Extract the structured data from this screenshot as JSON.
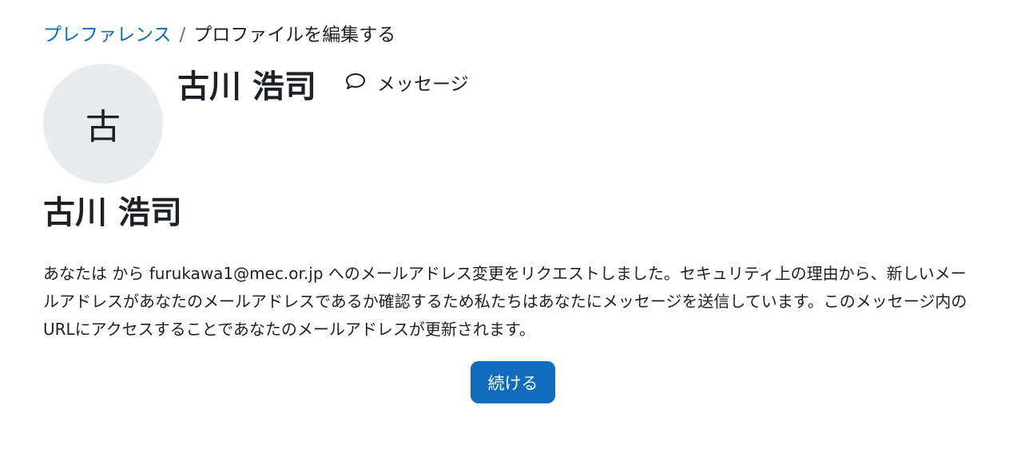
{
  "breadcrumb": {
    "items": [
      {
        "label": "プレファレンス"
      },
      {
        "label": "プロファイルを編集する"
      }
    ],
    "separator": "/"
  },
  "profile": {
    "avatar_initial": "古",
    "name": "古川 浩司",
    "message_label": "メッセージ",
    "message_icon": "chat-bubble-icon"
  },
  "page": {
    "heading": "古川 浩司",
    "body": "あなたは から furukawa1@mec.or.jp へのメールアドレス変更をリクエストしました。セキュリティ上の理由から、新しいメールアドレスがあなたのメールアドレスであるか確認するため私たちはあなたにメッセージを送信しています。このメッセージ内のURLにアクセスすることであなたのメールアドレスが更新されます。",
    "continue_label": "続ける"
  },
  "colors": {
    "link": "#0f6cbf",
    "primary_button": "#0f6cbf",
    "avatar_bg": "#e9ecef",
    "text": "#1d2125"
  }
}
